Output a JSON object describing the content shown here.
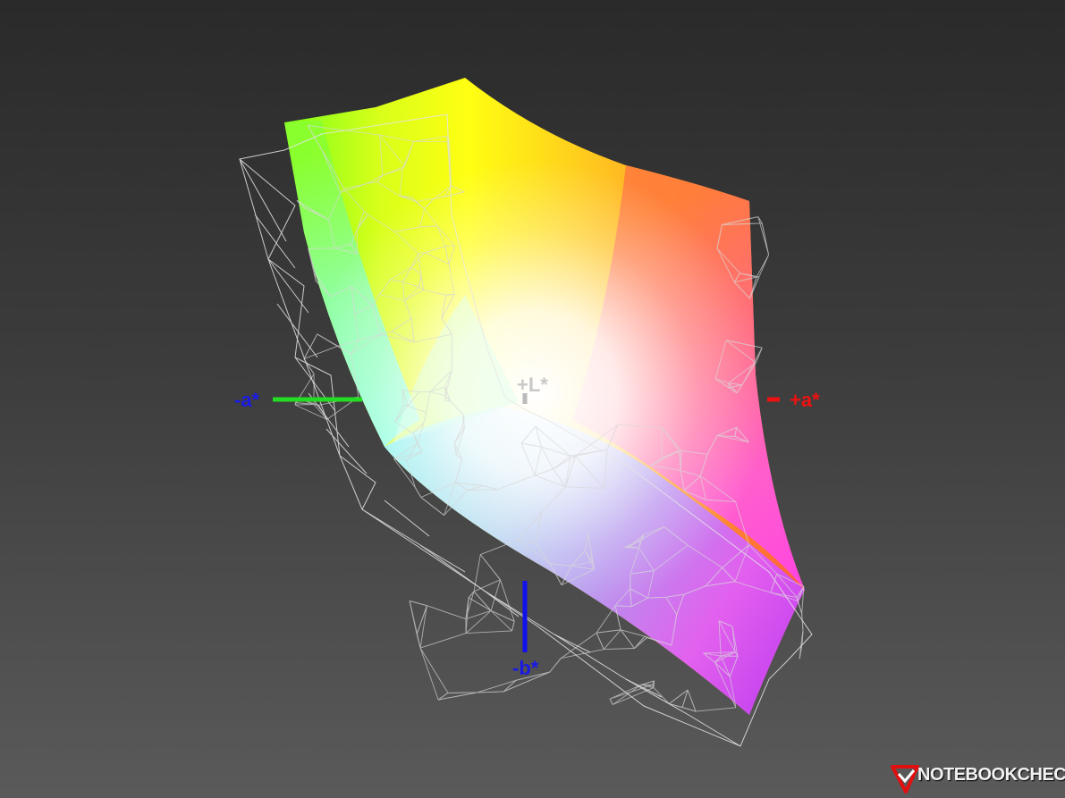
{
  "axes": {
    "plus_l": "+L*",
    "minus_a": "-a*",
    "plus_a": "+a*",
    "minus_b": "-b*"
  },
  "colors": {
    "minus_a_axis": "#22dd22",
    "plus_a_axis": "#ee1111",
    "minus_b_axis": "#1111ee",
    "plus_l_axis": "#bbbbbb",
    "label_blue": "#1a1ae6",
    "label_red": "#ee1111",
    "wireframe": "#e8e8e8"
  },
  "logo": {
    "text": "NOTEBOOKCHECK",
    "icon": "notebookcheck-check-icon"
  }
}
